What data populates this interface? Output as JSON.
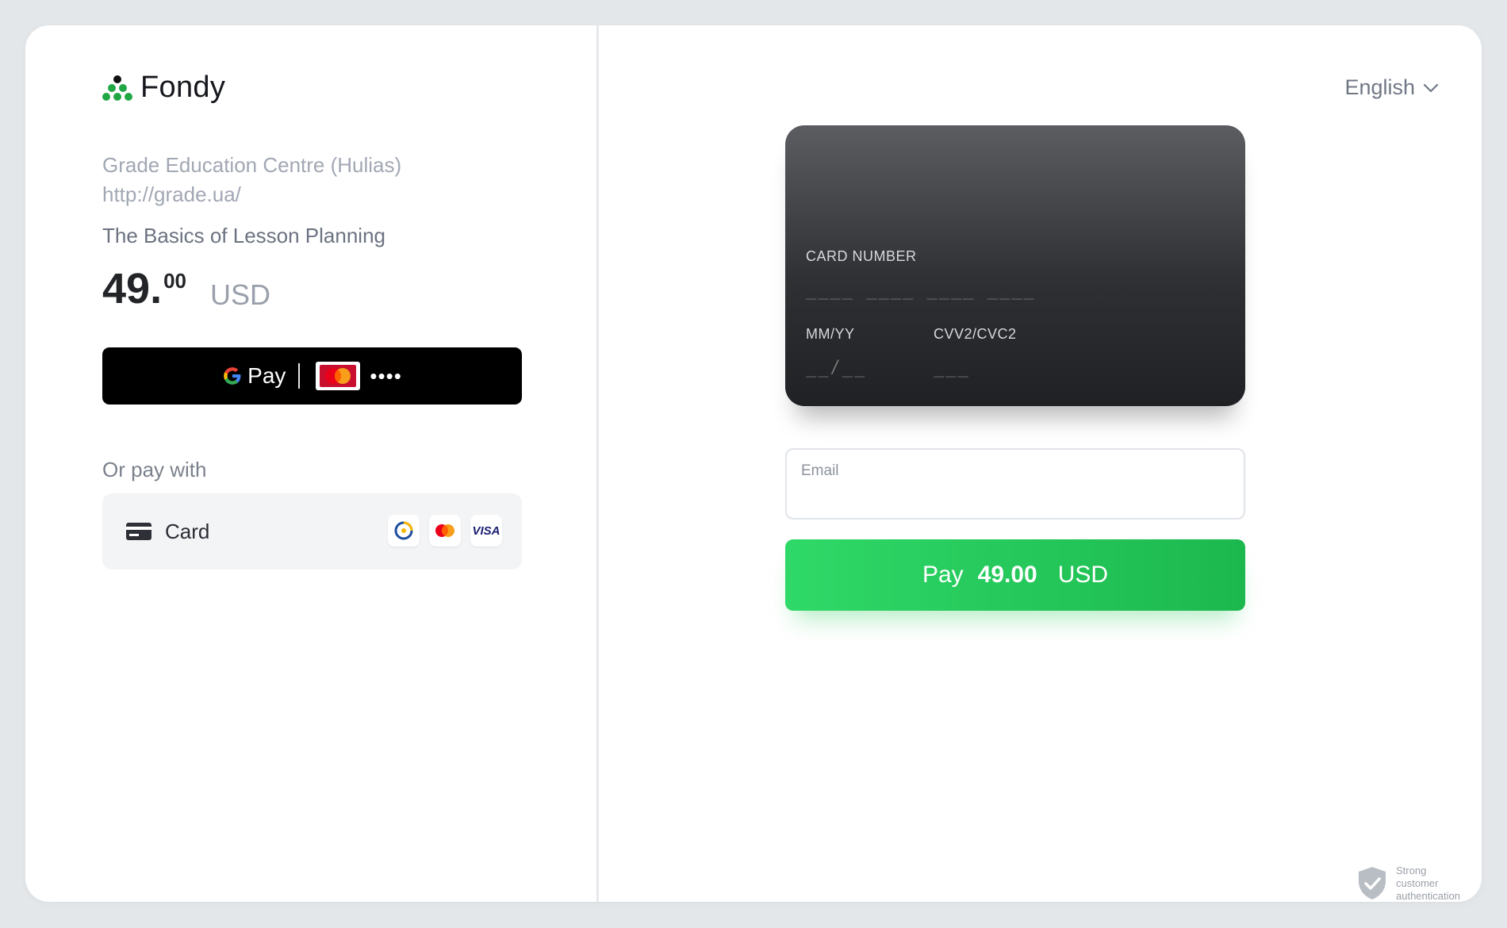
{
  "brand": {
    "name": "Fondy",
    "icon": "fondy-logo-icon",
    "color": "#22a745"
  },
  "merchant": {
    "name": "Grade Education Centre (Hulias)",
    "url": "http://grade.ua/"
  },
  "product": {
    "title": "The Basics of Lesson Planning"
  },
  "amount": {
    "integer": "49.",
    "decimal": "00",
    "currency": "USD"
  },
  "gpay": {
    "label": "Pay",
    "card_brand": "mastercard",
    "card_masked": "••••"
  },
  "or_pay_with": "Or pay with",
  "card_option": {
    "label": "Card",
    "icon": "credit-card-icon",
    "brands": [
      "prostir-icon",
      "mastercard-icon",
      "visa-icon"
    ],
    "visa_text": "VISA"
  },
  "language": {
    "selected": "English"
  },
  "card_form": {
    "number_label": "CARD NUMBER",
    "number_placeholder": "____ ____ ____ ____",
    "expiry_label": "MM/YY",
    "expiry_placeholder": "__/__",
    "cvv_label": "CVV2/CVC2",
    "cvv_placeholder": "___"
  },
  "email": {
    "label": "Email",
    "value": ""
  },
  "pay_button": {
    "prefix": "Pay",
    "amount": "49.00",
    "currency": "USD",
    "color": "#22c55e"
  },
  "sca": {
    "line1": "Strong",
    "line2": "customer",
    "line3": "authentication"
  }
}
